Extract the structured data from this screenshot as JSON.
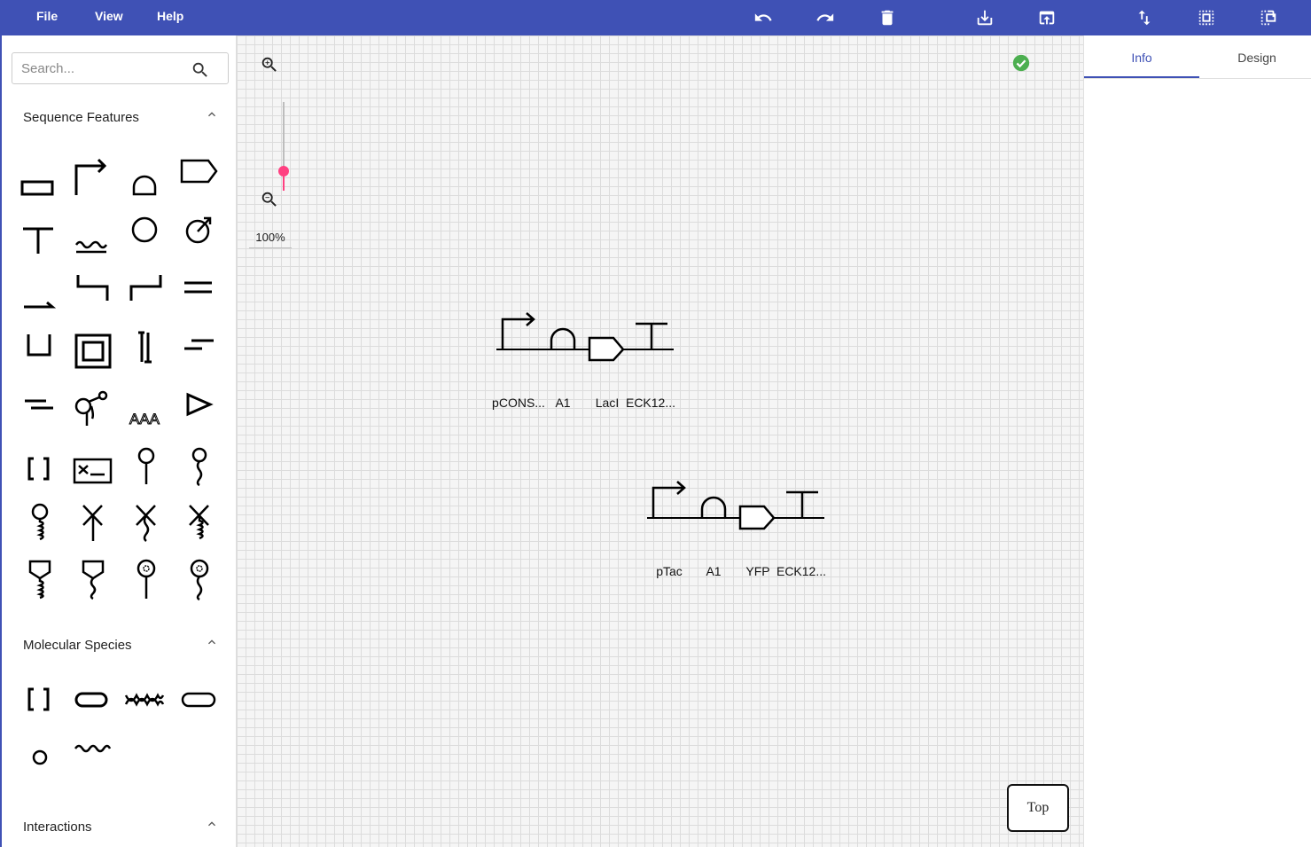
{
  "menu": {
    "file": "File",
    "view": "View",
    "help": "Help"
  },
  "toolbar": {
    "icons": [
      "undo-icon",
      "redo-icon",
      "delete-icon",
      "download-icon",
      "upload-icon",
      "swap-vertical-icon",
      "select-region-icon",
      "copy-selection-icon"
    ]
  },
  "sidebar": {
    "search_placeholder": "Search...",
    "sections": {
      "sequence_features": "Sequence Features",
      "molecular_species": "Molecular Species",
      "interactions": "Interactions"
    },
    "sequence_feature_glyphs": [
      "cds",
      "promoter",
      "ribosome-entry-site",
      "terminator-arrow",
      "terminator",
      "operator-wavy",
      "circle",
      "origin-of-transfer",
      "insulator-arrow",
      "sticky-end-5",
      "sticky-end-3",
      "blunt-restriction-site",
      "assembly-scar",
      "chromosomal-locus",
      "five-prime-overhang",
      "three-prime-overhang",
      "signature",
      "aptamer",
      "polyA",
      "primer-binding-site",
      "bracket",
      "composite",
      "specific-recombination-site",
      "location-dna",
      "location-rna",
      "location-protein",
      "cleavage-dna",
      "cleavage-rna",
      "stem-top-dna",
      "stem-top-rna",
      "non-coding-rna",
      "location-wavy"
    ],
    "sequence_feature_aaa_text": "AAA",
    "molecular_species_glyphs": [
      "complex",
      "protein",
      "macromolecule",
      "rounded-rect",
      "small-molecule",
      "dna-strand"
    ]
  },
  "canvas": {
    "zoom_level": "100%",
    "zoom_fraction": 0.22,
    "status": "valid",
    "top_button": "Top",
    "constructs": [
      {
        "labels": [
          "pCONS...",
          "A1",
          "LacI",
          "ECK12..."
        ]
      },
      {
        "labels": [
          "pTac",
          "A1",
          "YFP",
          "ECK12..."
        ]
      }
    ]
  },
  "right_panel": {
    "tabs": [
      "Info",
      "Design"
    ],
    "active_tab": "Info"
  },
  "colors": {
    "primary": "#3f51b5",
    "accent": "#ff4081",
    "success": "#4caf50"
  }
}
